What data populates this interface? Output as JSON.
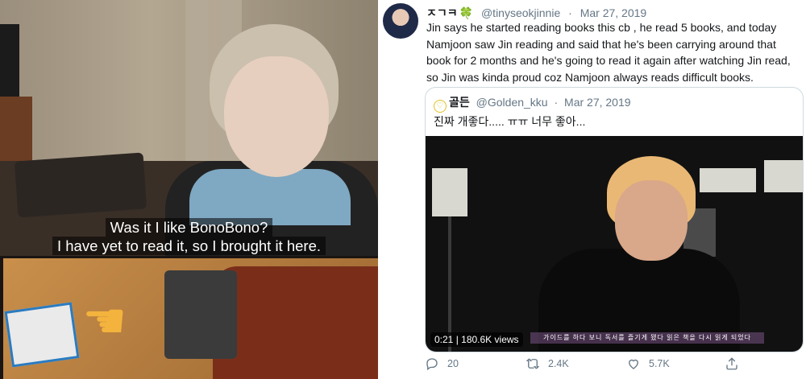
{
  "left_video": {
    "subtitle_line1": "Was it I like BonoBono?",
    "subtitle_line2": "I have yet to read it, so I brought it here."
  },
  "tweet": {
    "display_name": "ㅈㄱㅋ",
    "display_name_emoji": "🍀",
    "handle": "@tinyseokjinnie",
    "separator": "·",
    "date": "Mar 27, 2019",
    "text": "Jin says he started reading books this cb , he read 5 books, and today Namjoon saw Jin reading and said that he's been carrying around that book for 2 months and he's going to read it again after watching Jin read, so Jin was kinda proud coz Namjoon always reads difficult books.",
    "quoted": {
      "display_name": "골든",
      "handle": "@Golden_kku",
      "separator": "·",
      "date": "Mar 27, 2019",
      "text": "진짜 개좋다..... ㅠㅠ 너무 좋아...",
      "video_time": "0:21",
      "video_views": "180.6K views",
      "video_caption": "가이드를 하다 보니 독서를 즐기게 됐다 읽은 책을 다시 읽게 되었다"
    },
    "actions": {
      "reply_count": "20",
      "retweet_count": "2.4K",
      "like_count": "5.7K"
    }
  },
  "icons": [
    "reply-icon",
    "retweet-icon",
    "like-icon",
    "share-icon",
    "clover-icon",
    "heart-avatar-icon",
    "pointing-hand-icon"
  ]
}
